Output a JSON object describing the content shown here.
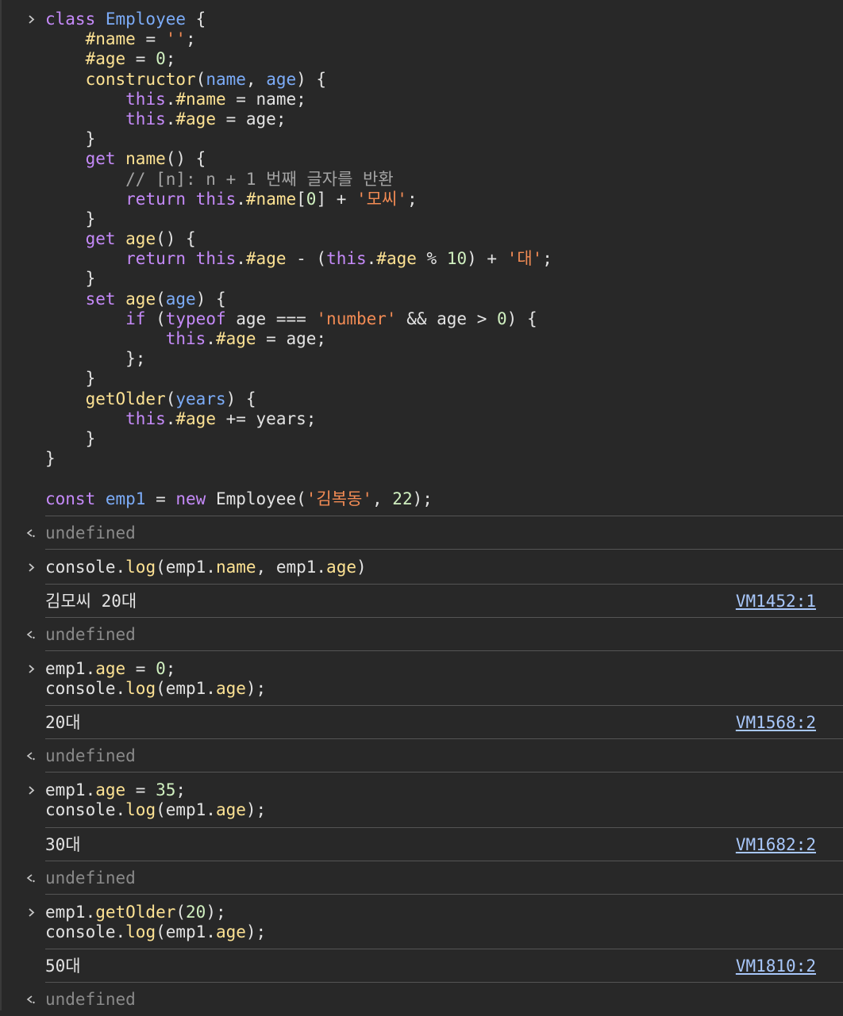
{
  "code_block": {
    "lines": [
      [
        [
          "k",
          "class "
        ],
        [
          "c",
          "Employee"
        ],
        [
          "t",
          " {"
        ]
      ],
      [
        [
          "t",
          "    "
        ],
        [
          "p",
          "#name"
        ],
        [
          "t",
          " = "
        ],
        [
          "s",
          "''"
        ],
        [
          "t",
          ";"
        ]
      ],
      [
        [
          "t",
          "    "
        ],
        [
          "p",
          "#age"
        ],
        [
          "t",
          " = "
        ],
        [
          "n",
          "0"
        ],
        [
          "t",
          ";"
        ]
      ],
      [
        [
          "t",
          "    "
        ],
        [
          "p",
          "constructor"
        ],
        [
          "t",
          "("
        ],
        [
          "c",
          "name"
        ],
        [
          "t",
          ", "
        ],
        [
          "c",
          "age"
        ],
        [
          "t",
          ") {"
        ]
      ],
      [
        [
          "t",
          "        "
        ],
        [
          "k",
          "this"
        ],
        [
          "t",
          "."
        ],
        [
          "p",
          "#name"
        ],
        [
          "t",
          " = name;"
        ]
      ],
      [
        [
          "t",
          "        "
        ],
        [
          "k",
          "this"
        ],
        [
          "t",
          "."
        ],
        [
          "p",
          "#age"
        ],
        [
          "t",
          " = age;"
        ]
      ],
      [
        [
          "t",
          "    }"
        ]
      ],
      [
        [
          "t",
          "    "
        ],
        [
          "k",
          "get "
        ],
        [
          "p",
          "name"
        ],
        [
          "t",
          "() {"
        ]
      ],
      [
        [
          "t",
          "        "
        ],
        [
          "cm",
          "// [n]: n + 1 번째 글자를 반환"
        ]
      ],
      [
        [
          "t",
          "        "
        ],
        [
          "k",
          "return "
        ],
        [
          "k",
          "this"
        ],
        [
          "t",
          "."
        ],
        [
          "p",
          "#name"
        ],
        [
          "t",
          "["
        ],
        [
          "n",
          "0"
        ],
        [
          "t",
          "] + "
        ],
        [
          "s",
          "'모씨'"
        ],
        [
          "t",
          ";"
        ]
      ],
      [
        [
          "t",
          "    }"
        ]
      ],
      [
        [
          "t",
          "    "
        ],
        [
          "k",
          "get "
        ],
        [
          "p",
          "age"
        ],
        [
          "t",
          "() {"
        ]
      ],
      [
        [
          "t",
          "        "
        ],
        [
          "k",
          "return "
        ],
        [
          "k",
          "this"
        ],
        [
          "t",
          "."
        ],
        [
          "p",
          "#age"
        ],
        [
          "t",
          " - ("
        ],
        [
          "k",
          "this"
        ],
        [
          "t",
          "."
        ],
        [
          "p",
          "#age"
        ],
        [
          "t",
          " % "
        ],
        [
          "n",
          "10"
        ],
        [
          "t",
          ") + "
        ],
        [
          "s",
          "'대'"
        ],
        [
          "t",
          ";"
        ]
      ],
      [
        [
          "t",
          "    }"
        ]
      ],
      [
        [
          "t",
          "    "
        ],
        [
          "k",
          "set "
        ],
        [
          "p",
          "age"
        ],
        [
          "t",
          "("
        ],
        [
          "c",
          "age"
        ],
        [
          "t",
          ") {"
        ]
      ],
      [
        [
          "t",
          "        "
        ],
        [
          "k",
          "if"
        ],
        [
          "t",
          " ("
        ],
        [
          "k",
          "typeof"
        ],
        [
          "t",
          " age === "
        ],
        [
          "s",
          "'number'"
        ],
        [
          "t",
          " && age > "
        ],
        [
          "n",
          "0"
        ],
        [
          "t",
          ") {"
        ]
      ],
      [
        [
          "t",
          "            "
        ],
        [
          "k",
          "this"
        ],
        [
          "t",
          "."
        ],
        [
          "p",
          "#age"
        ],
        [
          "t",
          " = age;"
        ]
      ],
      [
        [
          "t",
          "        };"
        ]
      ],
      [
        [
          "t",
          "    }"
        ]
      ],
      [
        [
          "t",
          "    "
        ],
        [
          "p",
          "getOlder"
        ],
        [
          "t",
          "("
        ],
        [
          "c",
          "years"
        ],
        [
          "t",
          ") {"
        ]
      ],
      [
        [
          "t",
          "        "
        ],
        [
          "k",
          "this"
        ],
        [
          "t",
          "."
        ],
        [
          "p",
          "#age"
        ],
        [
          "t",
          " += years;"
        ]
      ],
      [
        [
          "t",
          "    }"
        ]
      ],
      [
        [
          "t",
          "}"
        ]
      ],
      [
        [
          "t",
          ""
        ]
      ],
      [
        [
          "k",
          "const "
        ],
        [
          "c",
          "emp1"
        ],
        [
          "t",
          " = "
        ],
        [
          "k",
          "new "
        ],
        [
          "t",
          "Employee("
        ],
        [
          "s",
          "'김복동'"
        ],
        [
          "t",
          ", "
        ],
        [
          "n",
          "22"
        ],
        [
          "t",
          ");"
        ]
      ]
    ]
  },
  "results": {
    "r1": "undefined",
    "r2": "undefined",
    "r3": "undefined",
    "r4": "undefined",
    "r5": "undefined"
  },
  "inputs": {
    "i2": [
      [
        [
          "t",
          "console."
        ],
        [
          "p",
          "log"
        ],
        [
          "t",
          "(emp1."
        ],
        [
          "p",
          "name"
        ],
        [
          "t",
          ", emp1."
        ],
        [
          "p",
          "age"
        ],
        [
          "t",
          ")"
        ]
      ]
    ],
    "i3": [
      [
        [
          "t",
          "emp1."
        ],
        [
          "p",
          "age"
        ],
        [
          "t",
          " = "
        ],
        [
          "n",
          "0"
        ],
        [
          "t",
          ";"
        ]
      ],
      [
        [
          "t",
          "console."
        ],
        [
          "p",
          "log"
        ],
        [
          "t",
          "(emp1."
        ],
        [
          "p",
          "age"
        ],
        [
          "t",
          ");"
        ]
      ]
    ],
    "i4": [
      [
        [
          "t",
          "emp1."
        ],
        [
          "p",
          "age"
        ],
        [
          "t",
          " = "
        ],
        [
          "n",
          "35"
        ],
        [
          "t",
          ";"
        ]
      ],
      [
        [
          "t",
          "console."
        ],
        [
          "p",
          "log"
        ],
        [
          "t",
          "(emp1."
        ],
        [
          "p",
          "age"
        ],
        [
          "t",
          ");"
        ]
      ]
    ],
    "i5": [
      [
        [
          "t",
          "emp1."
        ],
        [
          "p",
          "getOlder"
        ],
        [
          "t",
          "("
        ],
        [
          "n",
          "20"
        ],
        [
          "t",
          ");"
        ]
      ],
      [
        [
          "t",
          "console."
        ],
        [
          "p",
          "log"
        ],
        [
          "t",
          "(emp1."
        ],
        [
          "p",
          "age"
        ],
        [
          "t",
          ");"
        ]
      ]
    ]
  },
  "logs": {
    "l1": {
      "text": "김모씨 20대",
      "source": "VM1452:1"
    },
    "l2": {
      "text": "20대",
      "source": "VM1568:2"
    },
    "l3": {
      "text": "30대",
      "source": "VM1682:2"
    },
    "l4": {
      "text": "50대",
      "source": "VM1810:2"
    }
  },
  "icons": {
    "prompt": "chevron-right-icon",
    "result": "return-arrow-icon"
  }
}
